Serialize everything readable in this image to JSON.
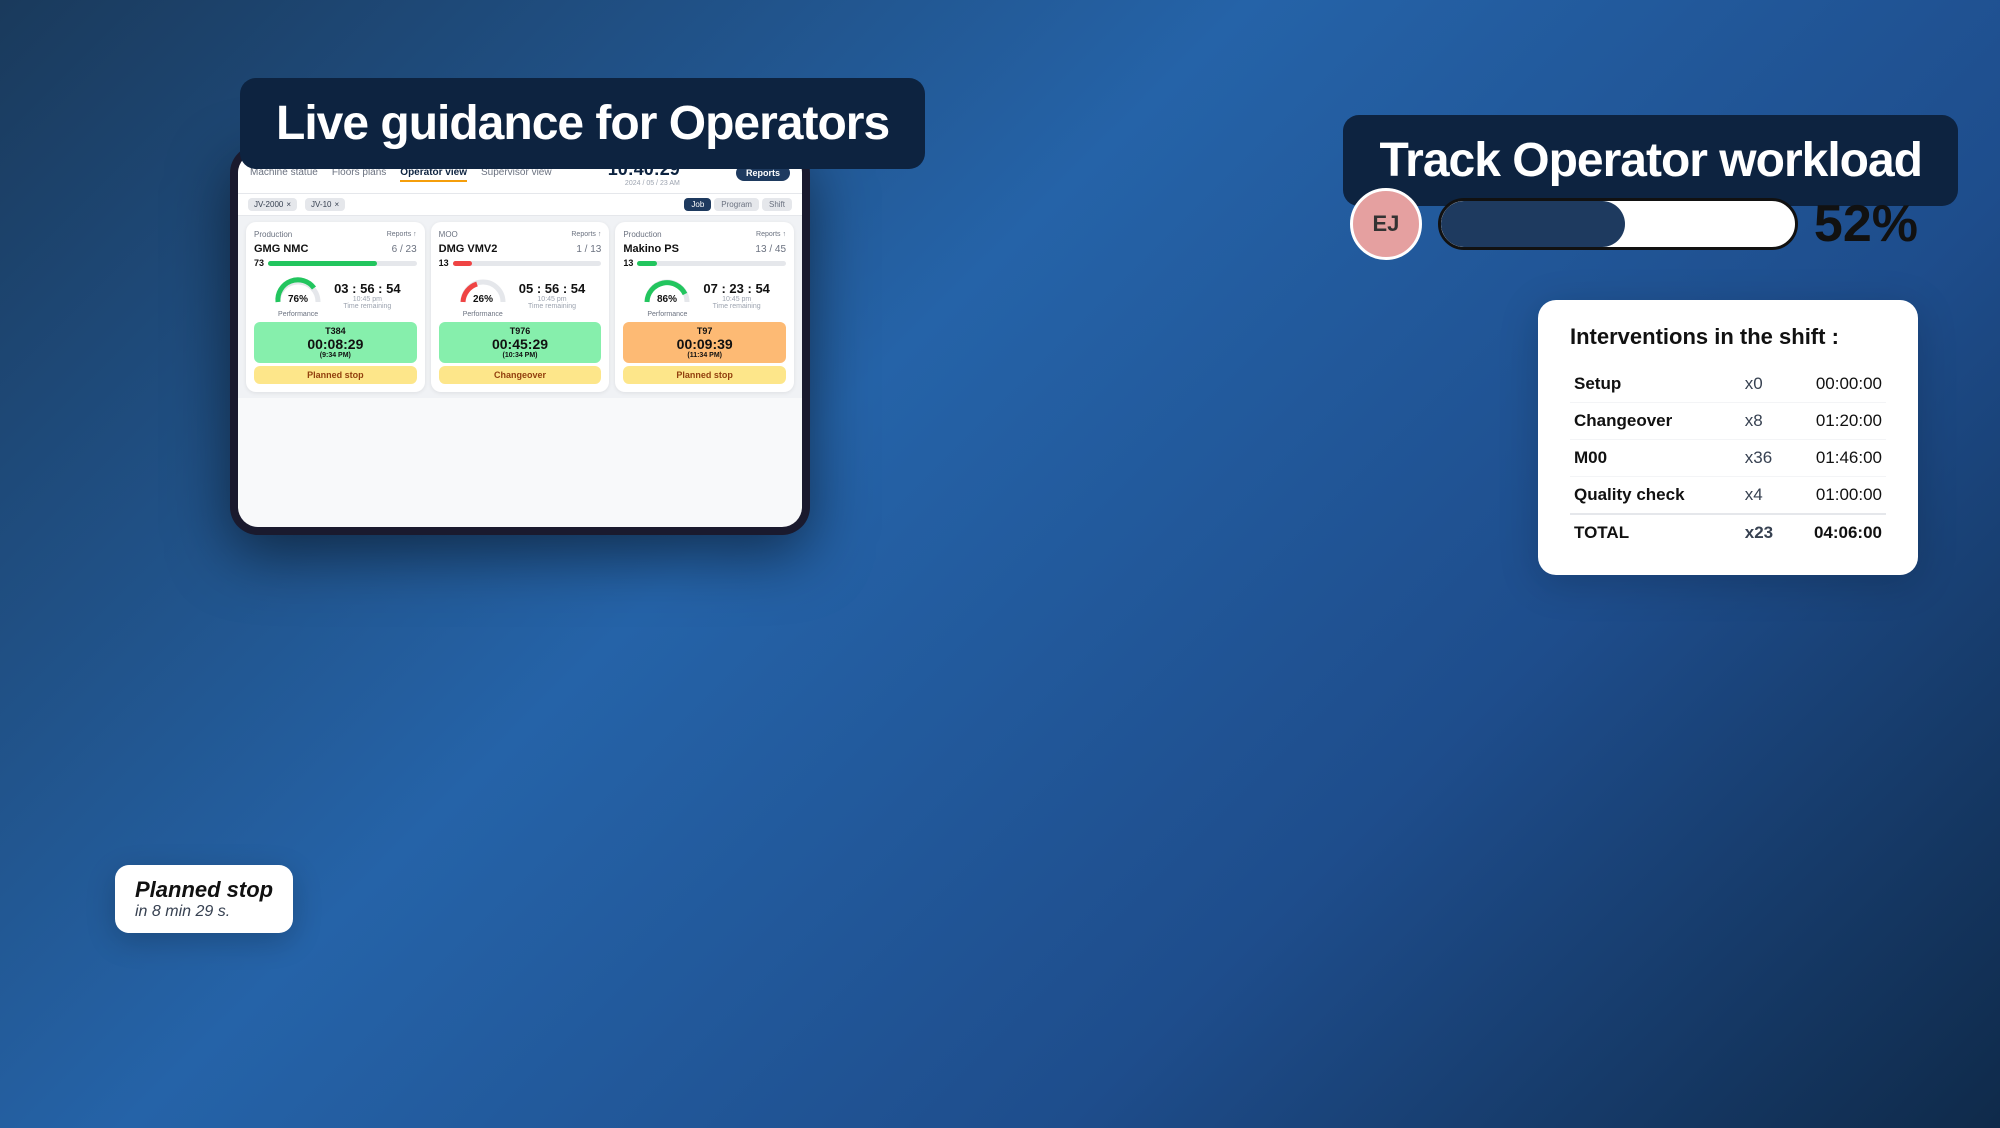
{
  "page": {
    "background_color": "#1a3a5c"
  },
  "left_section": {
    "badge_text": "Live guidance for Operators",
    "tablet": {
      "nav_tabs": [
        "Machine statue",
        "Floors plans",
        "Operator view",
        "Supervisor view"
      ],
      "active_tab": "Operator view",
      "time": "10:40:29",
      "date": "2024 / 05 / 23",
      "period": "AM",
      "reports_btn": "Reports",
      "filter_chips": [
        "JV-2000",
        "JV-10"
      ],
      "tab_pills": [
        "Job",
        "Program",
        "Shift"
      ],
      "machines": [
        {
          "section": "Production",
          "name": "GMG NMC",
          "count": "6 / 23",
          "progress_pct": 73,
          "gauge_pct": 76,
          "gauge_color": "green",
          "time": "03 : 56 : 54",
          "time_note": "10:45 pm",
          "time_label": "Time remaining",
          "task_id": "T384",
          "task_time": "00:08:29",
          "task_sub": "(9:34 PM)",
          "status": "Planned stop"
        },
        {
          "section": "MOO",
          "name": "DMG VMV2",
          "count": "1 / 13",
          "progress_pct": 13,
          "gauge_pct": 26,
          "gauge_color": "red",
          "time": "05 : 56 : 54",
          "time_note": "10:45 pm",
          "time_label": "Time remaining",
          "task_id": "T976",
          "task_time": "00:45:29",
          "task_sub": "(10:34 PM)",
          "status": "Changeover"
        },
        {
          "section": "Production",
          "name": "Makino PS",
          "count": "13 / 45",
          "progress_pct": 13,
          "gauge_pct": 86,
          "gauge_color": "green",
          "time": "07 : 23 : 54",
          "time_note": "10:45 pm",
          "time_label": "Time remaining",
          "task_id": "T97",
          "task_time": "00:09:39",
          "task_sub": "(11:34 PM)",
          "status": "Planned stop"
        }
      ]
    },
    "planned_stop_bubble": {
      "title": "Planned stop",
      "subtitle": "in 8 min 29 s."
    }
  },
  "right_section": {
    "badge_text": "Track Operator workload",
    "operator": {
      "initials": "EJ",
      "progress": 52,
      "progress_label": "52%"
    },
    "interventions": {
      "title": "Interventions in the shift :",
      "rows": [
        {
          "label": "Setup",
          "count": "x0",
          "time": "00:00:00"
        },
        {
          "label": "Changeover",
          "count": "x8",
          "time": "01:20:00"
        },
        {
          "label": "M00",
          "count": "x36",
          "time": "01:46:00"
        },
        {
          "label": "Quality check",
          "count": "x4",
          "time": "01:00:00"
        },
        {
          "label": "TOTAL",
          "count": "x23",
          "time": "04:06:00",
          "is_total": true
        }
      ]
    }
  }
}
